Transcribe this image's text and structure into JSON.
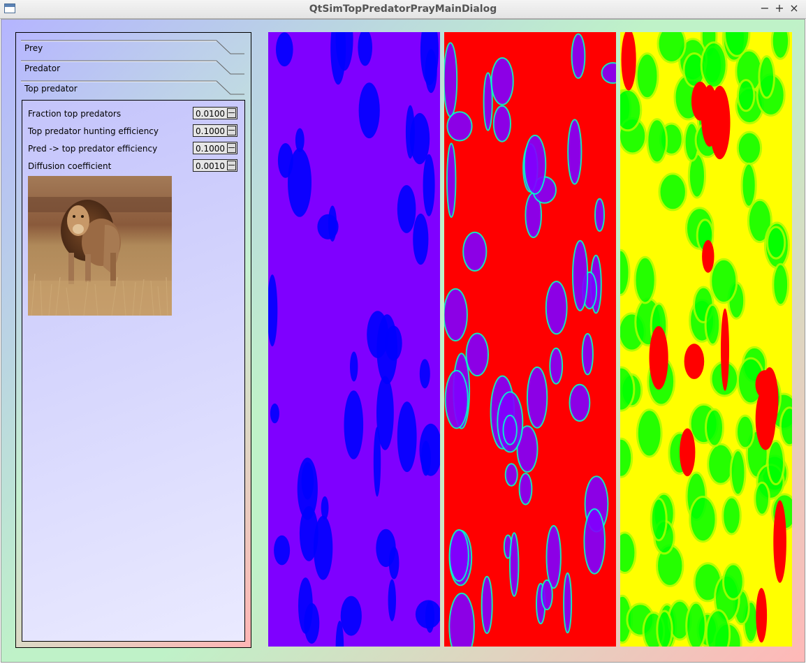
{
  "window": {
    "title": "QtSimTopPredatorPrayMainDialog",
    "minimize": "−",
    "maximize": "+",
    "close": "×"
  },
  "toolbox": {
    "tabs": [
      {
        "label": "Prey"
      },
      {
        "label": "Predator"
      },
      {
        "label": "Top predator"
      }
    ]
  },
  "top_predator": {
    "params": [
      {
        "label": "Fraction top predators",
        "value": "0.0100"
      },
      {
        "label": "Top predator hunting efficiency",
        "value": "0.1000"
      },
      {
        "label": "Pred -> top predator efficiency",
        "value": "0.1000"
      },
      {
        "label": "Diffusion coefficient",
        "value": "0.0010"
      }
    ],
    "photo_subject": "lion"
  },
  "plots": [
    {
      "name": "prey",
      "base_color": "#7f00ff",
      "blob_color": "#0000ff"
    },
    {
      "name": "predator",
      "base_color": "#ff0000",
      "blob_color": "#8000ff"
    },
    {
      "name": "top-predator",
      "base_color": "#ffff00",
      "blob_color": "#00ff00"
    }
  ]
}
